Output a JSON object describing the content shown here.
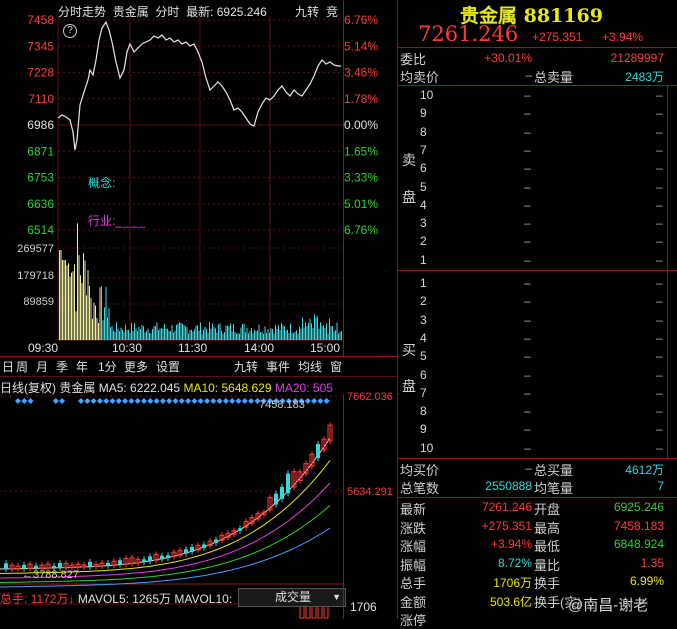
{
  "intraday": {
    "title": "分时走势",
    "name": "贵金属",
    "mode": "分时",
    "latest_label": "最新:",
    "latest_value": "6925.246",
    "jiuzhuan": "九转",
    "jing": "竞",
    "price_ticks": [
      "7458",
      "7345",
      "7228",
      "7110",
      "6986",
      "6871",
      "6753",
      "6636",
      "6514"
    ],
    "pct_ticks": [
      "6.76%",
      "5.14%",
      "3.46%",
      "1.78%",
      "0.00%",
      "1.65%",
      "3.33%",
      "5.01%",
      "6.76%"
    ],
    "volume_ticks": [
      "269577",
      "179718",
      "89859"
    ],
    "time_ticks": [
      "09:30",
      "10:30",
      "11:30",
      "14:00",
      "15:00"
    ],
    "concept_label": "概念:",
    "industry_label": "行业:"
  },
  "toolbar": {
    "tabs": [
      "日",
      "周",
      "月",
      "季",
      "年",
      "1分",
      "更多",
      "设置"
    ],
    "right_tabs": [
      "九转",
      "事件",
      "均线",
      "窗"
    ]
  },
  "kline": {
    "header_prefix": "日线(复权)",
    "name": "贵金属",
    "ma5_label": "MA5: 6222.045",
    "ma10_label": "MA10: 5648.629",
    "ma20_label": "MA20: 505",
    "high_marker": "7458.183",
    "low_marker": "3788.827",
    "axis_top": "7662.036",
    "axis_mid": "5634.291",
    "vol_label": "总手: 1172万↓",
    "mavol5": "MAVOL5: 1265万",
    "mavol10": "MAVOL10: ",
    "vol_select": "成交量",
    "vol_axis": "1706"
  },
  "quote": {
    "title": "贵金属 881169",
    "price": "7261.246",
    "change": "+275.351",
    "change_pct": "+3.94%",
    "weibi_label": "委比",
    "weibi_value": "+30.01%",
    "weibi_diff": "21289997",
    "avg_sell_label": "均卖价",
    "avg_sell_value": "–",
    "total_sell_label": "总卖量",
    "total_sell_value": "2483万",
    "sell_label": [
      "卖",
      "盘"
    ],
    "buy_label": [
      "买",
      "盘"
    ],
    "sell_levels": [
      "10",
      "9",
      "8",
      "7",
      "6",
      "5",
      "4",
      "3",
      "2",
      "1"
    ],
    "buy_levels": [
      "1",
      "2",
      "3",
      "4",
      "5",
      "6",
      "7",
      "8",
      "9",
      "10"
    ],
    "dash": "–",
    "avg_buy_label": "均买价",
    "avg_buy_value": "–",
    "total_buy_label": "总买量",
    "total_buy_value": "4612万",
    "total_trades_label": "总笔数",
    "total_trades_value": "2550888",
    "avg_trade_label": "均笔量",
    "avg_trade_value": "7",
    "stats": [
      {
        "l1": "最新",
        "v1": "7261.246",
        "c1": "red",
        "l2": "开盘",
        "v2": "6925.246",
        "c2": "green"
      },
      {
        "l1": "涨跌",
        "v1": "+275.351",
        "c1": "red",
        "l2": "最高",
        "v2": "7458.183",
        "c2": "red"
      },
      {
        "l1": "涨幅",
        "v1": "+3.94%",
        "c1": "red",
        "l2": "最低",
        "v2": "6848.924",
        "c2": "green"
      },
      {
        "l1": "振幅",
        "v1": "8.72%",
        "c1": "cyan",
        "l2": "量比",
        "v2": "1.35",
        "c2": "red"
      },
      {
        "l1": "总手",
        "v1": "1706万",
        "c1": "yellow",
        "l2": "换手",
        "v2": "6.99%",
        "c2": "yellow"
      },
      {
        "l1": "金额",
        "v1": "503.6亿",
        "c1": "yellow",
        "l2": "换手(实)",
        "v2": "",
        "c2": "yellow"
      },
      {
        "l1": "涨停",
        "v1": "",
        "c1": "red",
        "l2": "",
        "v2": "",
        "c2": "red"
      }
    ],
    "watermark": "@南昌-谢老"
  }
}
